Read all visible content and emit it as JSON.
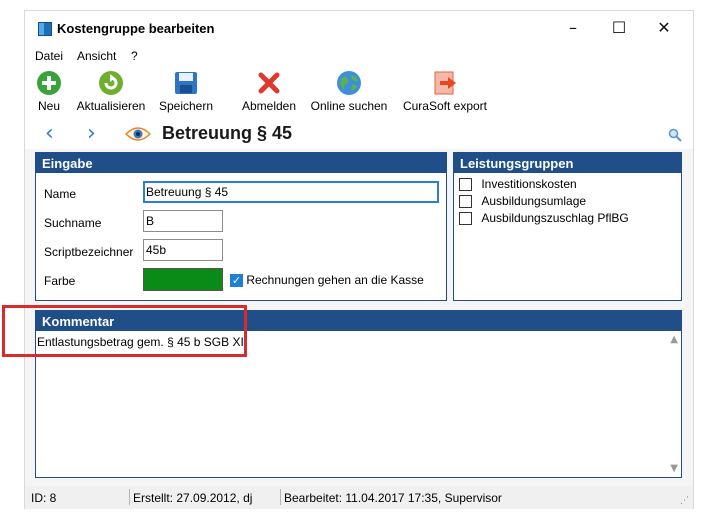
{
  "window": {
    "title": "Kostengruppe bearbeiten",
    "controls": {
      "minimize": "–",
      "maximize": "☐",
      "close": "✕"
    }
  },
  "menu": [
    "Datei",
    "Ansicht",
    "?"
  ],
  "toolbar": [
    {
      "label": "Neu",
      "icon": "plus-circle-icon"
    },
    {
      "label": "Aktualisieren",
      "icon": "refresh-icon"
    },
    {
      "label": "Speichern",
      "icon": "save-icon"
    },
    {
      "label": "Abmelden",
      "icon": "close-x-icon"
    },
    {
      "label": "Online suchen",
      "icon": "globe-icon"
    },
    {
      "label": "CuraSoft export",
      "icon": "export-icon"
    }
  ],
  "nav": {
    "back": "‹",
    "forward": "›",
    "title": "Betreuung § 45"
  },
  "eingabe": {
    "header": "Eingabe",
    "name_label": "Name",
    "name_value": "Betreuung § 45",
    "suchname_label": "Suchname",
    "suchname_value": "B",
    "script_label": "Scriptbezeichner",
    "script_value": "45b",
    "farbe_label": "Farbe",
    "farbe_color": "#0a8a16",
    "kasse_label": "Rechnungen gehen an die Kasse",
    "kasse_checked": true
  },
  "leistungsgruppen": {
    "header": "Leistungsgruppen",
    "items": [
      {
        "label": "Investitionskosten",
        "checked": false
      },
      {
        "label": "Ausbildungsumlage",
        "checked": false
      },
      {
        "label": "Ausbildungszuschlag PflBG",
        "checked": false
      }
    ]
  },
  "kommentar": {
    "header": "Kommentar",
    "text": "Entlastungsbetrag gem. § 45 b SGB XI"
  },
  "status": {
    "id": "ID: 8",
    "erstellt": "Erstellt: 27.09.2012, dj",
    "bearbeitet": "Bearbeitet: 11.04.2017 17:35, Supervisor"
  },
  "colors": {
    "accent": "#1f4e88",
    "highlight": "#d82c2c",
    "link": "#2a7fd4"
  }
}
